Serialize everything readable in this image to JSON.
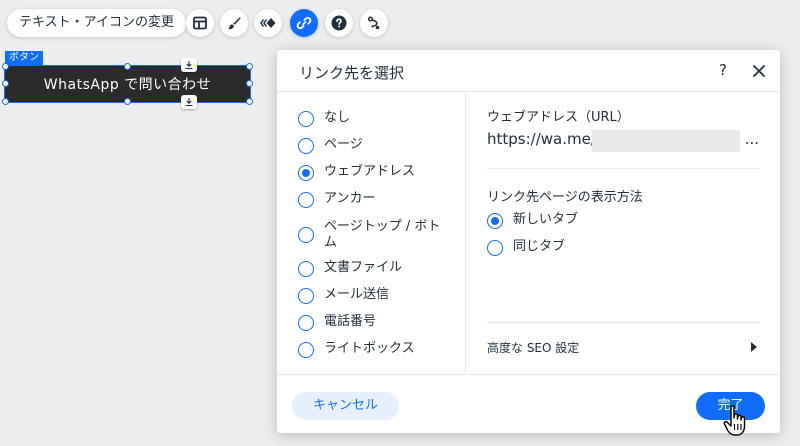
{
  "toolbar": {
    "change_text_icon_label": "テキスト・アイコンの変更",
    "icons": [
      "layout-icon",
      "brush-icon",
      "animation-icon",
      "link-icon",
      "help-icon",
      "connect-icon"
    ],
    "active_icon": "link-icon"
  },
  "canvas": {
    "selection_tag": "ボタン",
    "button_text": "WhatsApp で問い合わせ"
  },
  "dialog": {
    "title": "リンク先を選択",
    "help": "?",
    "link_types": [
      {
        "label": "なし",
        "selected": false
      },
      {
        "label": "ページ",
        "selected": false
      },
      {
        "label": "ウェブアドレス",
        "selected": true
      },
      {
        "label": "アンカー",
        "selected": false
      },
      {
        "label": "ページトップ / ボトム",
        "selected": false
      },
      {
        "label": "文書ファイル",
        "selected": false
      },
      {
        "label": "メール送信",
        "selected": false
      },
      {
        "label": "電話番号",
        "selected": false
      },
      {
        "label": "ライトボックス",
        "selected": false
      }
    ],
    "url_section_label": "ウェブアドレス（URL）",
    "url_value": "https://wa.me/",
    "url_ellipsis": "...",
    "open_mode_label": "リンク先ページの表示方法",
    "open_modes": [
      {
        "label": "新しいタブ",
        "selected": true
      },
      {
        "label": "同じタブ",
        "selected": false
      }
    ],
    "advanced_seo_label": "高度な SEO 設定",
    "cancel_label": "キャンセル",
    "done_label": "完了"
  },
  "colors": {
    "accent": "#116dff",
    "accent_light": "#e7f0ff",
    "text": "#20303c",
    "canvas_bg": "#eceef0",
    "button_bg": "#2b2b2b"
  }
}
